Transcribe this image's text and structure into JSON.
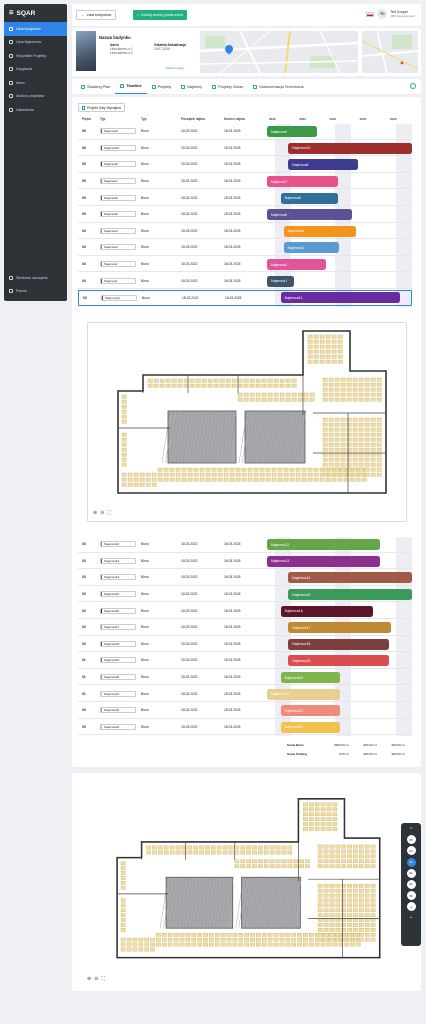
{
  "sidebar": {
    "logo": "SQAR",
    "items": [
      {
        "label": "Lista budynków",
        "icon": "building-icon",
        "active": true
      },
      {
        "label": "Lista Najemców",
        "icon": "users-icon"
      },
      {
        "label": "Wszystkie Projekty",
        "icon": "projects-icon"
      },
      {
        "label": "Dopytania",
        "icon": "question-icon"
      },
      {
        "label": "Inbox",
        "icon": "inbox-icon"
      },
      {
        "label": "Analiza projektów",
        "icon": "chart-icon"
      },
      {
        "label": "Ustawienia",
        "icon": "gear-icon"
      }
    ],
    "bottom": [
      {
        "label": "Skrótowe narzędzia",
        "icon": "tools-icon"
      },
      {
        "label": "Pomoc",
        "icon": "help-icon"
      }
    ]
  },
  "topbar": {
    "back_label": "Lista budynków",
    "search_label": "Szukaj wolnej powierzchni",
    "user_initials": "TC",
    "user_name": "Ted Cooper",
    "user_company": "ABC Development"
  },
  "building": {
    "name": "Nazwa budynku",
    "address_label": "Adres",
    "address_line1": "Linia adresu n.1",
    "address_line2": "Linia adresu n.2",
    "updated_label": "Ostatnia Aktualizacja",
    "updated_value": "15.07.2019",
    "map_link": "Otwórz mapę"
  },
  "tabs": [
    {
      "label": "Stacking Plan"
    },
    {
      "label": "Timeline",
      "active": true
    },
    {
      "label": "Projekty"
    },
    {
      "label": "Najemcy"
    },
    {
      "label": "Projekty Zmian"
    },
    {
      "label": "Dokumentacja Techniczna"
    }
  ],
  "timeline": {
    "project_button": "Projekt Sały Wynajmu",
    "headers": [
      "Piętro",
      "Typ",
      "Typ",
      "Początek najmu",
      "Koniec najmu"
    ],
    "years": [
      "2022",
      "2023",
      "2024",
      "2025",
      "2026"
    ],
    "year_start": 2022.0,
    "year_end": 2026.8,
    "section1": [
      {
        "floor": "06",
        "tenant": "Najemca9",
        "type": "Biuro",
        "start": "18.03.2022",
        "end": "18.03.2025",
        "color": "#3a9a47",
        "bar_start": 2022.0,
        "bar_end": 2023.65
      },
      {
        "floor": "06",
        "tenant": "Najemca10",
        "type": "Biuro",
        "start": "18.03.2022",
        "end": "18.03.2025",
        "color": "#9e2d2d",
        "bar_start": 2022.7,
        "bar_end": 2026.8
      },
      {
        "floor": "05",
        "tenant": "Najemca8",
        "type": "Biuro",
        "start": "18.03.2022",
        "end": "18.03.2025",
        "color": "#3c3b8f",
        "bar_start": 2022.7,
        "bar_end": 2025.0
      },
      {
        "floor": "05",
        "tenant": "Najemca7",
        "type": "Biuro",
        "start": "18.03.2022",
        "end": "18.03.2025",
        "color": "#e7528d",
        "bar_start": 2022.0,
        "bar_end": 2024.35
      },
      {
        "floor": "05",
        "tenant": "Najemca6",
        "type": "Biuro",
        "start": "18.03.2022",
        "end": "18.03.2025",
        "color": "#2f6f9a",
        "bar_start": 2022.45,
        "bar_end": 2024.35
      },
      {
        "floor": "05",
        "tenant": "Najemca5",
        "type": "Biuro",
        "start": "18.03.2022",
        "end": "18.03.2025",
        "color": "#5d5193",
        "bar_start": 2022.0,
        "bar_end": 2024.8
      },
      {
        "floor": "04",
        "tenant": "Najemca4",
        "type": "Biuro",
        "start": "18.03.2022",
        "end": "18.03.2025",
        "color": "#f3941e",
        "bar_start": 2022.55,
        "bar_end": 2024.95
      },
      {
        "floor": "04",
        "tenant": "Najemca3",
        "type": "Biuro",
        "start": "18.03.2022",
        "end": "18.03.2025",
        "color": "#5b9bd5",
        "bar_start": 2022.55,
        "bar_end": 2024.4
      },
      {
        "floor": "04",
        "tenant": "Najemca2",
        "type": "Biuro",
        "start": "18.03.2022",
        "end": "18.03.2025",
        "color": "#e3559a",
        "bar_start": 2022.0,
        "bar_end": 2023.95
      },
      {
        "floor": "04",
        "tenant": "Najemca1",
        "type": "Biuro",
        "start": "18.03.2022",
        "end": "18.03.2025",
        "color": "#3d5566",
        "bar_start": 2022.0,
        "bar_end": 2022.9
      },
      {
        "floor": "03",
        "tenant": "Najemca11",
        "type": "Biuro",
        "start": "18.03.2022",
        "end": "18.03.2025",
        "color": "#6a2aa0",
        "bar_start": 2022.45,
        "bar_end": 2026.4,
        "selected": true
      }
    ],
    "section2": [
      {
        "floor": "03",
        "tenant": "Najemca12",
        "type": "Biuro",
        "start": "18.03.2022",
        "end": "18.03.2025",
        "color": "#66a64a",
        "bar_start": 2022.0,
        "bar_end": 2025.75
      },
      {
        "floor": "03",
        "tenant": "Najemca13",
        "type": "Biuro",
        "start": "18.03.2022",
        "end": "18.03.2025",
        "color": "#8d2f8f",
        "bar_start": 2022.0,
        "bar_end": 2025.75
      },
      {
        "floor": "03",
        "tenant": "Najemca14",
        "type": "Biuro",
        "start": "18.03.2022",
        "end": "18.03.2025",
        "color": "#a25a48",
        "bar_start": 2022.7,
        "bar_end": 2026.8
      },
      {
        "floor": "02",
        "tenant": "Najemca15",
        "type": "Biuro",
        "start": "18.03.2022",
        "end": "18.03.2025",
        "color": "#3b9a5a",
        "bar_start": 2022.7,
        "bar_end": 2026.8
      },
      {
        "floor": "02",
        "tenant": "Najemca16",
        "type": "Biuro",
        "start": "18.03.2022",
        "end": "18.03.2025",
        "color": "#5b1625",
        "bar_start": 2022.45,
        "bar_end": 2025.5
      },
      {
        "floor": "02",
        "tenant": "Najemca17",
        "type": "Biuro",
        "start": "18.03.2022",
        "end": "18.03.2025",
        "color": "#c08a35",
        "bar_start": 2022.7,
        "bar_end": 2026.1
      },
      {
        "floor": "02",
        "tenant": "Najemca18",
        "type": "Biuro",
        "start": "18.03.2022",
        "end": "18.03.2025",
        "color": "#7d3e3e",
        "bar_start": 2022.7,
        "bar_end": 2026.05
      },
      {
        "floor": "01",
        "tenant": "Najemca19",
        "type": "Biuro",
        "start": "18.03.2022",
        "end": "18.03.2025",
        "color": "#d94e4e",
        "bar_start": 2022.7,
        "bar_end": 2026.05
      },
      {
        "floor": "01",
        "tenant": "Najemca20",
        "type": "Biuro",
        "start": "18.03.2022",
        "end": "18.03.2025",
        "color": "#7db54a",
        "bar_start": 2022.45,
        "bar_end": 2024.4
      },
      {
        "floor": "01",
        "tenant": "Najemca21",
        "type": "Biuro",
        "start": "18.03.2022",
        "end": "18.03.2025",
        "color": "#e6cf8f",
        "bar_start": 2022.0,
        "bar_end": 2024.4
      },
      {
        "floor": "00",
        "tenant": "Najemca22",
        "type": "Biuro",
        "start": "18.03.2022",
        "end": "18.03.2025",
        "color": "#f08a7a",
        "bar_start": 2022.45,
        "bar_end": 2024.4
      },
      {
        "floor": "00",
        "tenant": "Najemca23",
        "type": "Biuro",
        "start": "18.03.2022",
        "end": "18.03.2025",
        "color": "#f2c24e",
        "bar_start": 2022.45,
        "bar_end": 2024.4
      }
    ],
    "totals": [
      {
        "label": "Suma Biuro",
        "v1": "2986.00 m²",
        "v2": "980.00 m²",
        "v3": "980.00 m²"
      },
      {
        "label": "Suma Parking",
        "v1": "6.00 m²",
        "v2": "980.00 m²",
        "v3": "980.00 m²"
      }
    ]
  },
  "floor_nav": {
    "floors": [
      "05",
      "04",
      "03",
      "02",
      "01",
      "00",
      "-1"
    ],
    "active": "03"
  }
}
